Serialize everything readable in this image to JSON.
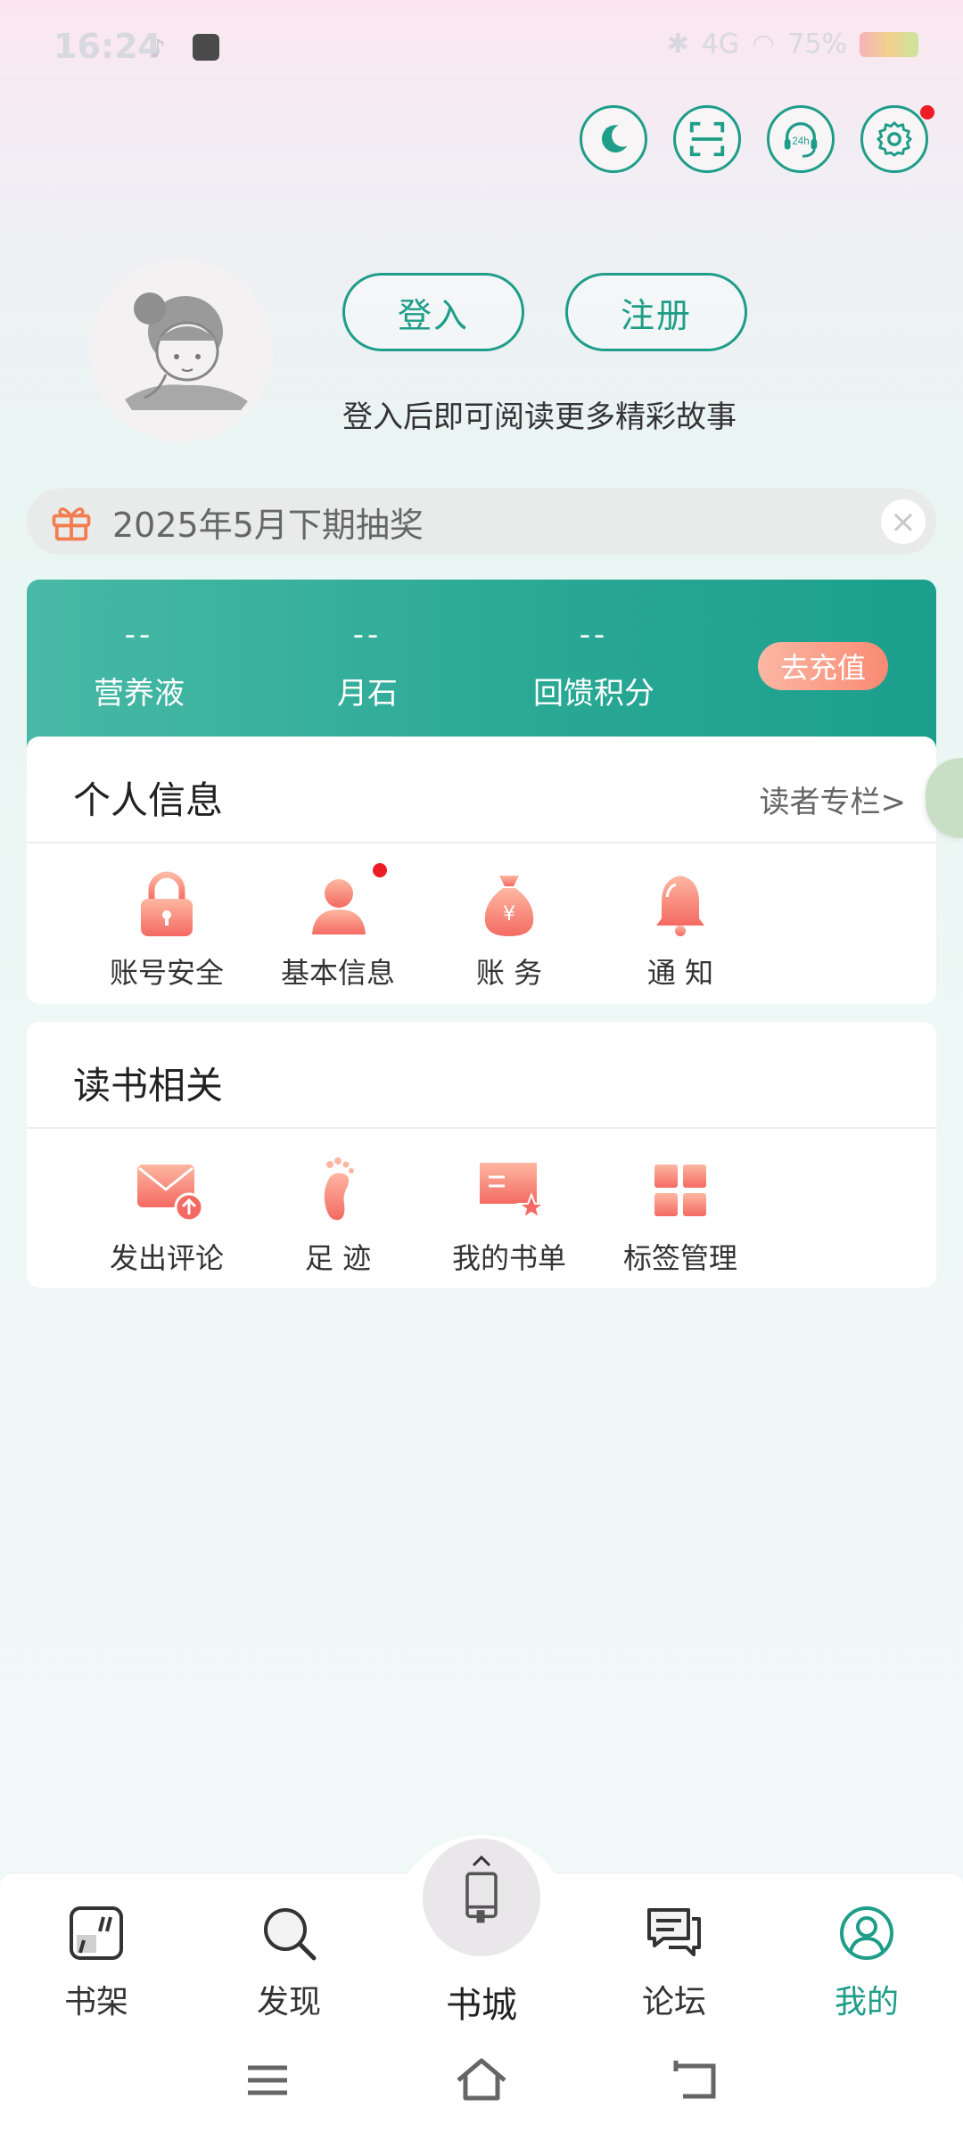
{
  "status_bar": {
    "time": "16:24",
    "network": "4G",
    "battery": "75%"
  },
  "top_icons": [
    "moon-icon",
    "scan-icon",
    "headset-24h-icon",
    "gear-icon"
  ],
  "profile": {
    "login_label": "登入",
    "register_label": "注册",
    "hint": "登入后即可阅读更多精彩故事"
  },
  "lottery": {
    "text": "2025年5月下期抽奖"
  },
  "wallet": {
    "items": [
      {
        "value": "--",
        "label": "营养液"
      },
      {
        "value": "--",
        "label": "月石"
      },
      {
        "value": "--",
        "label": "回馈积分"
      }
    ],
    "recharge_label": "去充值"
  },
  "personal": {
    "title": "个人信息",
    "link": "读者专栏>",
    "items": [
      {
        "label": "账号安全"
      },
      {
        "label": "基本信息"
      },
      {
        "label": "账  务"
      },
      {
        "label": "通  知"
      }
    ]
  },
  "reading": {
    "title": "读书相关",
    "items": [
      {
        "label": "发出评论"
      },
      {
        "label": "足 迹"
      },
      {
        "label": "我的书单"
      },
      {
        "label": "标签管理"
      }
    ]
  },
  "bottom_nav": {
    "items": [
      {
        "label": "书架"
      },
      {
        "label": "发现"
      },
      {
        "label": "书城"
      },
      {
        "label": "论坛"
      },
      {
        "label": "我的"
      }
    ],
    "active": "我的",
    "active_color": "#1e9d88"
  },
  "colors": {
    "accent": "#1e9d88",
    "icon_gradient_start": "#fcae9b",
    "icon_gradient_end": "#f46a62"
  }
}
